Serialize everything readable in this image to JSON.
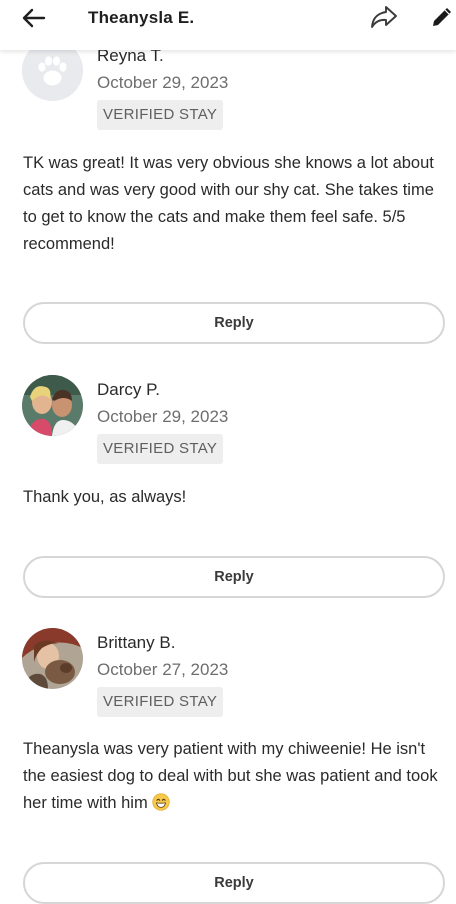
{
  "header": {
    "title": "Theanysla E.",
    "back_icon": "arrow-left-icon",
    "share_icon": "share-icon",
    "edit_icon": "pencil-icon"
  },
  "reviews": [
    {
      "name": "Reyna T.",
      "date": "October 29, 2023",
      "badge": "VERIFIED STAY",
      "text": "TK was great! It was very obvious she knows a lot about cats and was very good with our shy cat. She takes time to get to know the cats and make them feel safe. 5/5 recommend!",
      "reply_label": "Reply",
      "avatar_icon": "paw-icon"
    },
    {
      "name": "Darcy P.",
      "date": "October 29, 2023",
      "badge": "VERIFIED STAY",
      "text": "Thank you, as always!",
      "reply_label": "Reply",
      "avatar_icon": "user-photo"
    },
    {
      "name": "Brittany B.",
      "date": "October 27, 2023",
      "badge": "VERIFIED STAY",
      "text": "Theanysla was very patient with my chiweenie! He isn't the easiest dog to deal with but she was patient and took her time with him",
      "reply_label": "Reply",
      "avatar_icon": "user-photo",
      "emoji": "grinning-face-emoji"
    }
  ],
  "colors": {
    "text": "#2a2a2a",
    "muted": "#6e6e6e",
    "badge_bg": "#eeeeee",
    "button_border": "#d6d6d6",
    "emoji": "#f7c948"
  }
}
